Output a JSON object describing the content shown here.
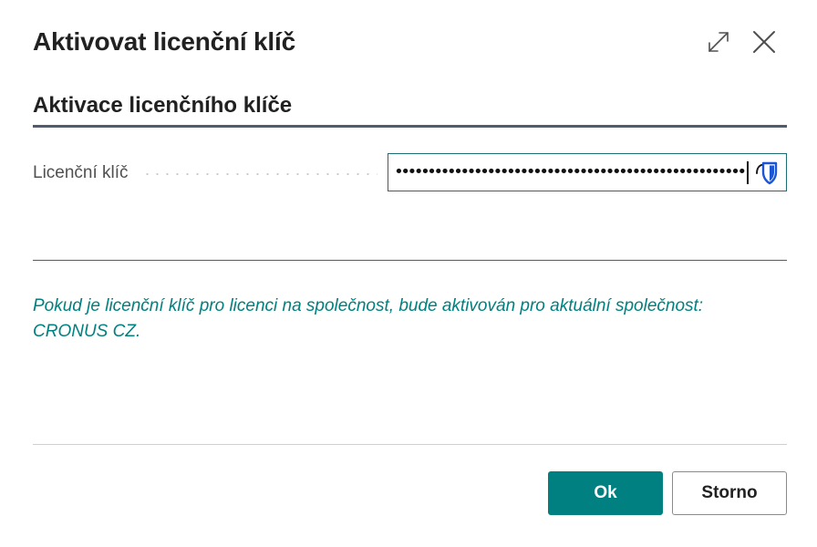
{
  "dialog": {
    "title": "Aktivovat licenční klíč"
  },
  "section": {
    "heading": "Aktivace licenčního klíče"
  },
  "field": {
    "label": "Licenční klíč",
    "value": "••••••••••••••••••••••••••••••••••••••••••••••••••••••••••••••••••"
  },
  "info": {
    "text": "Pokud je licenční klíč pro licenci na společnost, bude aktivován pro aktuální společnost: CRONUS CZ."
  },
  "buttons": {
    "ok_label": "Ok",
    "cancel_label": "Storno"
  },
  "colors": {
    "accent": "#008080",
    "info_text": "#00807f",
    "input_border": "#1b6e74",
    "rule": "#505c6d"
  },
  "icons": {
    "expand": "expand-icon",
    "close": "close-icon",
    "password_manager": "password-manager-shield-icon"
  }
}
